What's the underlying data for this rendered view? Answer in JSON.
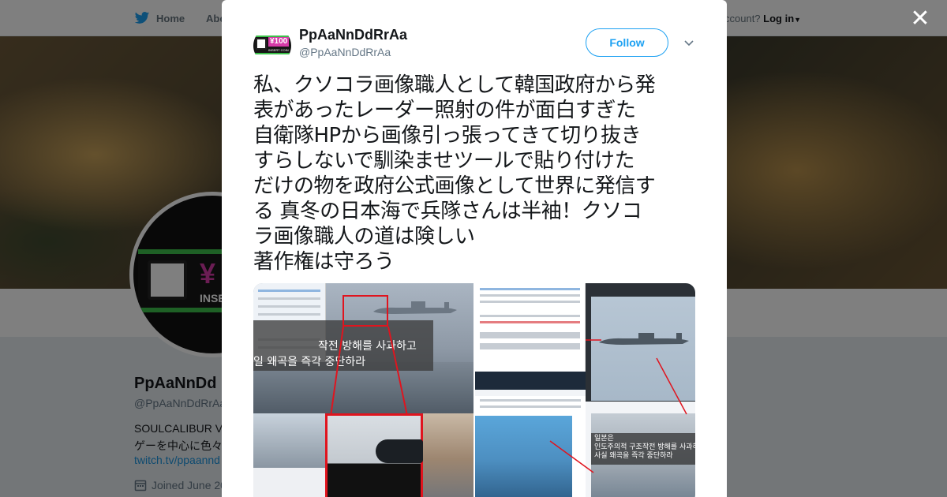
{
  "nav": {
    "home_label": "Home",
    "about_label": "Abo",
    "login_prompt": "ccount?",
    "login_label": "Log in"
  },
  "profile": {
    "name": "PpAaNnDd",
    "handle": "@PpAaNnDdRrAa",
    "bio_line1": "SOULCALIBUR V",
    "bio_line2": "ゲーを中心に色々",
    "link": "twitch.tv/ppaannd",
    "joined": "Joined June 20"
  },
  "tweet": {
    "author_name": "PpAaNnDdRrAa",
    "author_handle": "@PpAaNnDdRrAa",
    "follow_label": "Follow",
    "avatar_label": "¥100",
    "avatar_sub": "INSERT COIN",
    "text_lines": [
      "私、クソコラ画像職人として韓国政府から発",
      "表があったレーダー照射の件が面白すぎた",
      "自衛隊HPから画像引っ張ってきて切り抜き",
      "すらしないで馴染ませツールで貼り付けた",
      "だけの物を政府公式画像として世界に発信す",
      "る 真冬の日本海で兵隊さんは半袖！クソコ",
      "ラ画像職人の道は険しい",
      "著作権は守ろう"
    ],
    "media": {
      "photo1_caption_line1": "작전 방해를 사과하고",
      "photo1_caption_line2": "일 왜곡을 즉각 중단하라",
      "photo2_caption_line1": "일본은",
      "photo2_caption_line2": "인도주의적 구조작전 방해를 사과하고",
      "photo2_caption_line3": "사실 왜곡을 즉각 중단하라"
    }
  },
  "avatar_big": {
    "yen_label": "¥",
    "insert_label": "INSE"
  },
  "colors": {
    "twitter_blue": "#1da1f2",
    "link_blue": "#1b95e0",
    "accent_red": "#e0141e",
    "avatar_green": "#3cc14a",
    "avatar_pink": "#d63aa8"
  },
  "icons": {
    "nav_home": "twitter-bird-icon",
    "close": "close-icon",
    "chevron": "chevron-down-icon",
    "joined": "calendar-icon"
  }
}
